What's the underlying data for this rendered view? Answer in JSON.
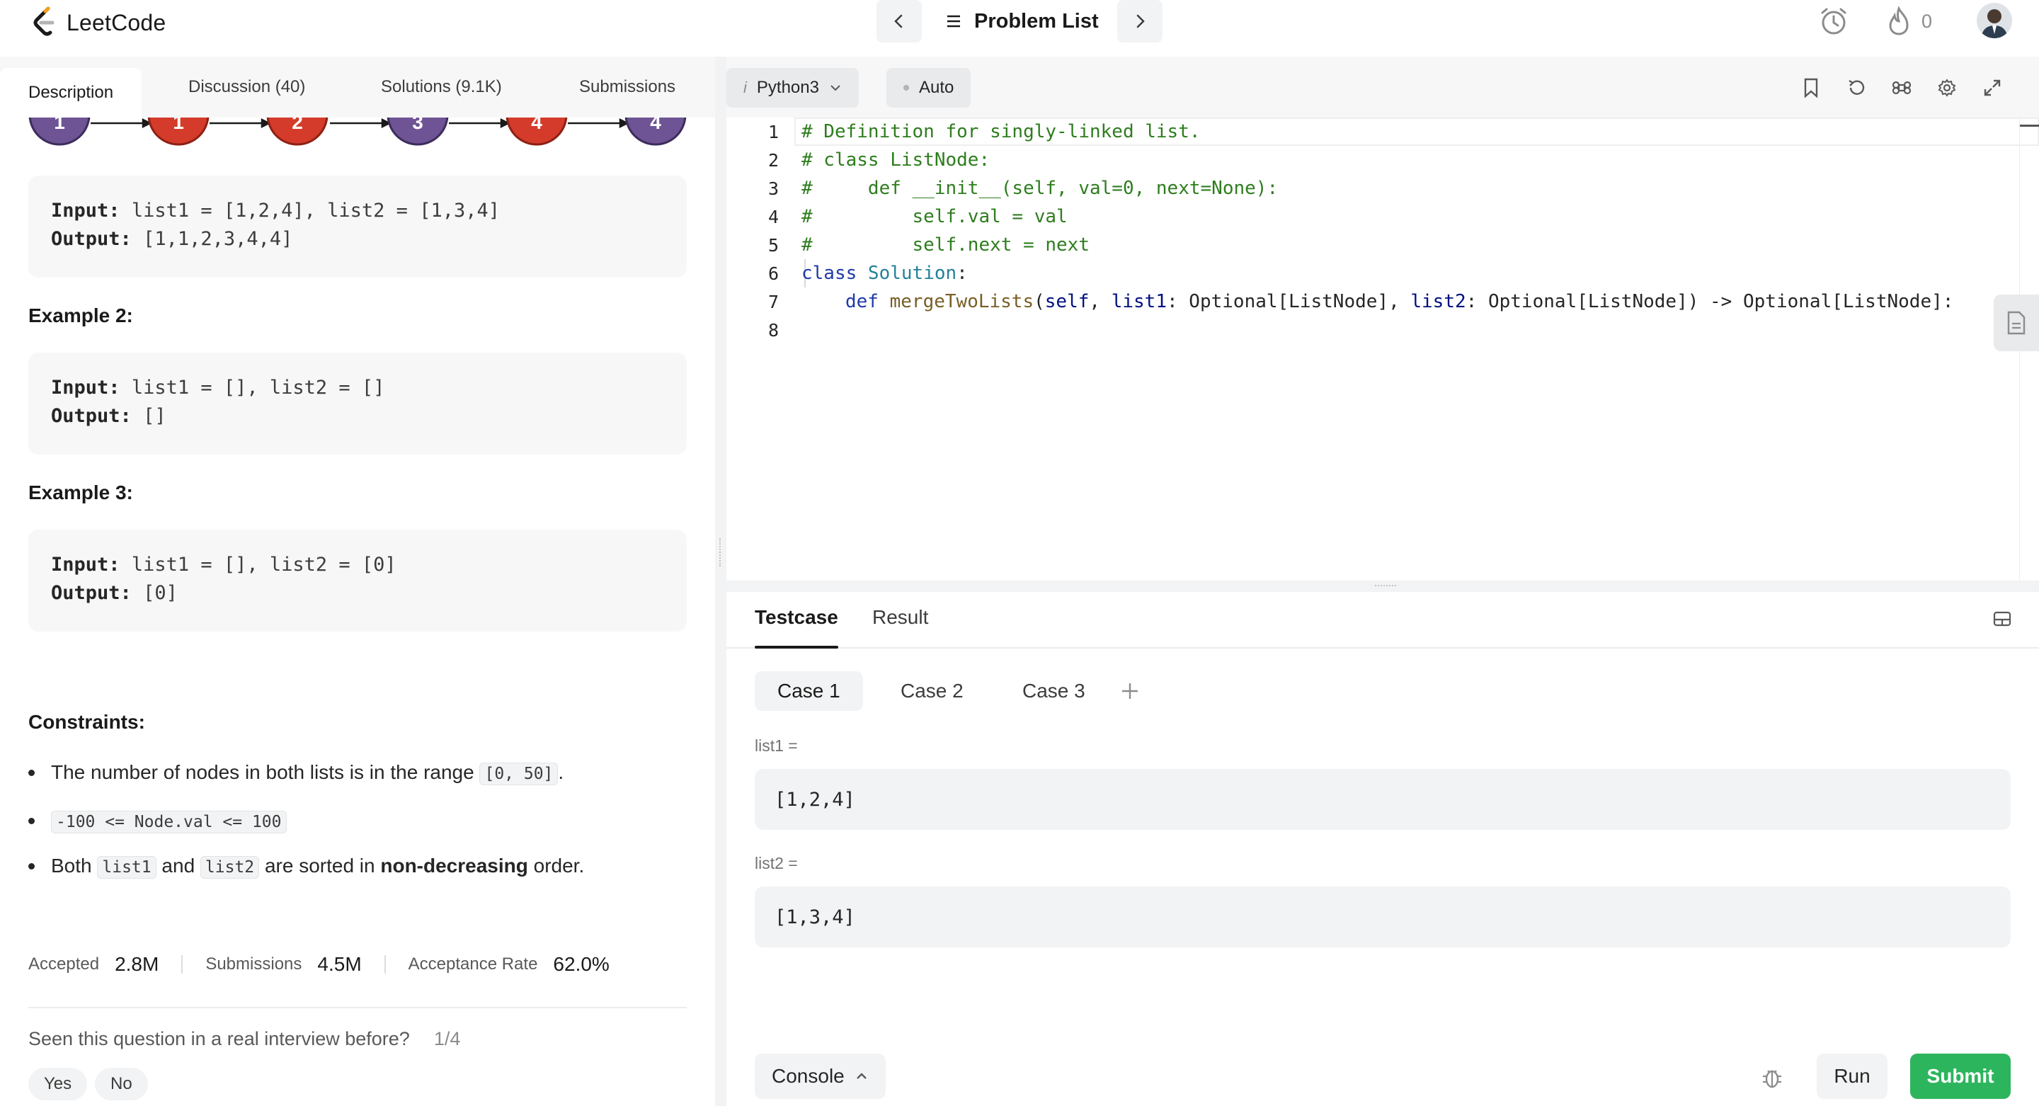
{
  "header": {
    "logo_text": "LeetCode",
    "problem_list_label": "Problem List",
    "streak_count": "0"
  },
  "left_tabs": [
    {
      "label": "Description"
    },
    {
      "label": "Discussion (40)"
    },
    {
      "label": "Solutions (9.1K)"
    },
    {
      "label": "Submissions"
    }
  ],
  "diagram_nodes": [
    "1",
    "1",
    "2",
    "3",
    "4",
    "4"
  ],
  "example1": {
    "input": "list1 = [1,2,4], list2 = [1,3,4]",
    "output": "[1,1,2,3,4,4]"
  },
  "example2": {
    "title": "Example 2:",
    "input": "list1 = [], list2 = []",
    "output": "[]"
  },
  "example3": {
    "title": "Example 3:",
    "input": "list1 = [], list2 = [0]",
    "output": "[0]"
  },
  "labels": {
    "input": "Input:",
    "output": "Output:"
  },
  "constraints": {
    "title": "Constraints:",
    "c1_text": "The number of nodes in both lists is in the range ",
    "c1_code": "[0, 50]",
    "c1_end": ".",
    "c2_code": "-100 <= Node.val <= 100",
    "c3_a": "Both ",
    "c3_code1": "list1",
    "c3_b": " and ",
    "c3_code2": "list2",
    "c3_c": " are sorted in ",
    "c3_bold": "non-decreasing",
    "c3_d": " order."
  },
  "stats": {
    "accepted_label": "Accepted",
    "accepted_value": "2.8M",
    "submissions_label": "Submissions",
    "submissions_value": "4.5M",
    "rate_label": "Acceptance Rate",
    "rate_value": "62.0%"
  },
  "interview": {
    "question": "Seen this question in a real interview before?",
    "progress": "1/4",
    "yes": "Yes",
    "no": "No"
  },
  "editor": {
    "language": "Python3",
    "mode": "Auto",
    "lines": [
      {
        "n": "1"
      },
      {
        "n": "2"
      },
      {
        "n": "3"
      },
      {
        "n": "4"
      },
      {
        "n": "5"
      },
      {
        "n": "6"
      },
      {
        "n": "7"
      },
      {
        "n": "8"
      }
    ],
    "code": {
      "l1": "# Definition for singly-linked list.",
      "l2": "# class ListNode:",
      "l3": "#     def __init__(self, val=0, next=None):",
      "l4": "#         self.val = val",
      "l5": "#         self.next = next",
      "l6_kw": "class",
      "l6_name": " Solution",
      "l6_end": ":",
      "l7_kw": "def",
      "l7_fn": " mergeTwoLists",
      "l7_a": "(",
      "l7_self": "self",
      "l7_b": ", ",
      "l7_p1": "list1",
      "l7_c": ": Optional[ListNode], ",
      "l7_p2": "list2",
      "l7_d": ": Optional[ListNode]) -> Optional[ListNode]:"
    }
  },
  "testcase": {
    "tabs": [
      {
        "label": "Testcase"
      },
      {
        "label": "Result"
      }
    ],
    "cases": [
      {
        "label": "Case 1"
      },
      {
        "label": "Case 2"
      },
      {
        "label": "Case 3"
      }
    ],
    "var1_label": "list1 =",
    "var1_value": "[1,2,4]",
    "var2_label": "list2 =",
    "var2_value": "[1,3,4]",
    "console_label": "Console",
    "run_label": "Run",
    "submit_label": "Submit"
  },
  "colors": {
    "node_purple": "#6e5494",
    "node_red": "#d53b2a",
    "submit_green": "#2db55d",
    "comment_green": "#2e7d1e",
    "keyword_blue": "#1f3aa8"
  }
}
